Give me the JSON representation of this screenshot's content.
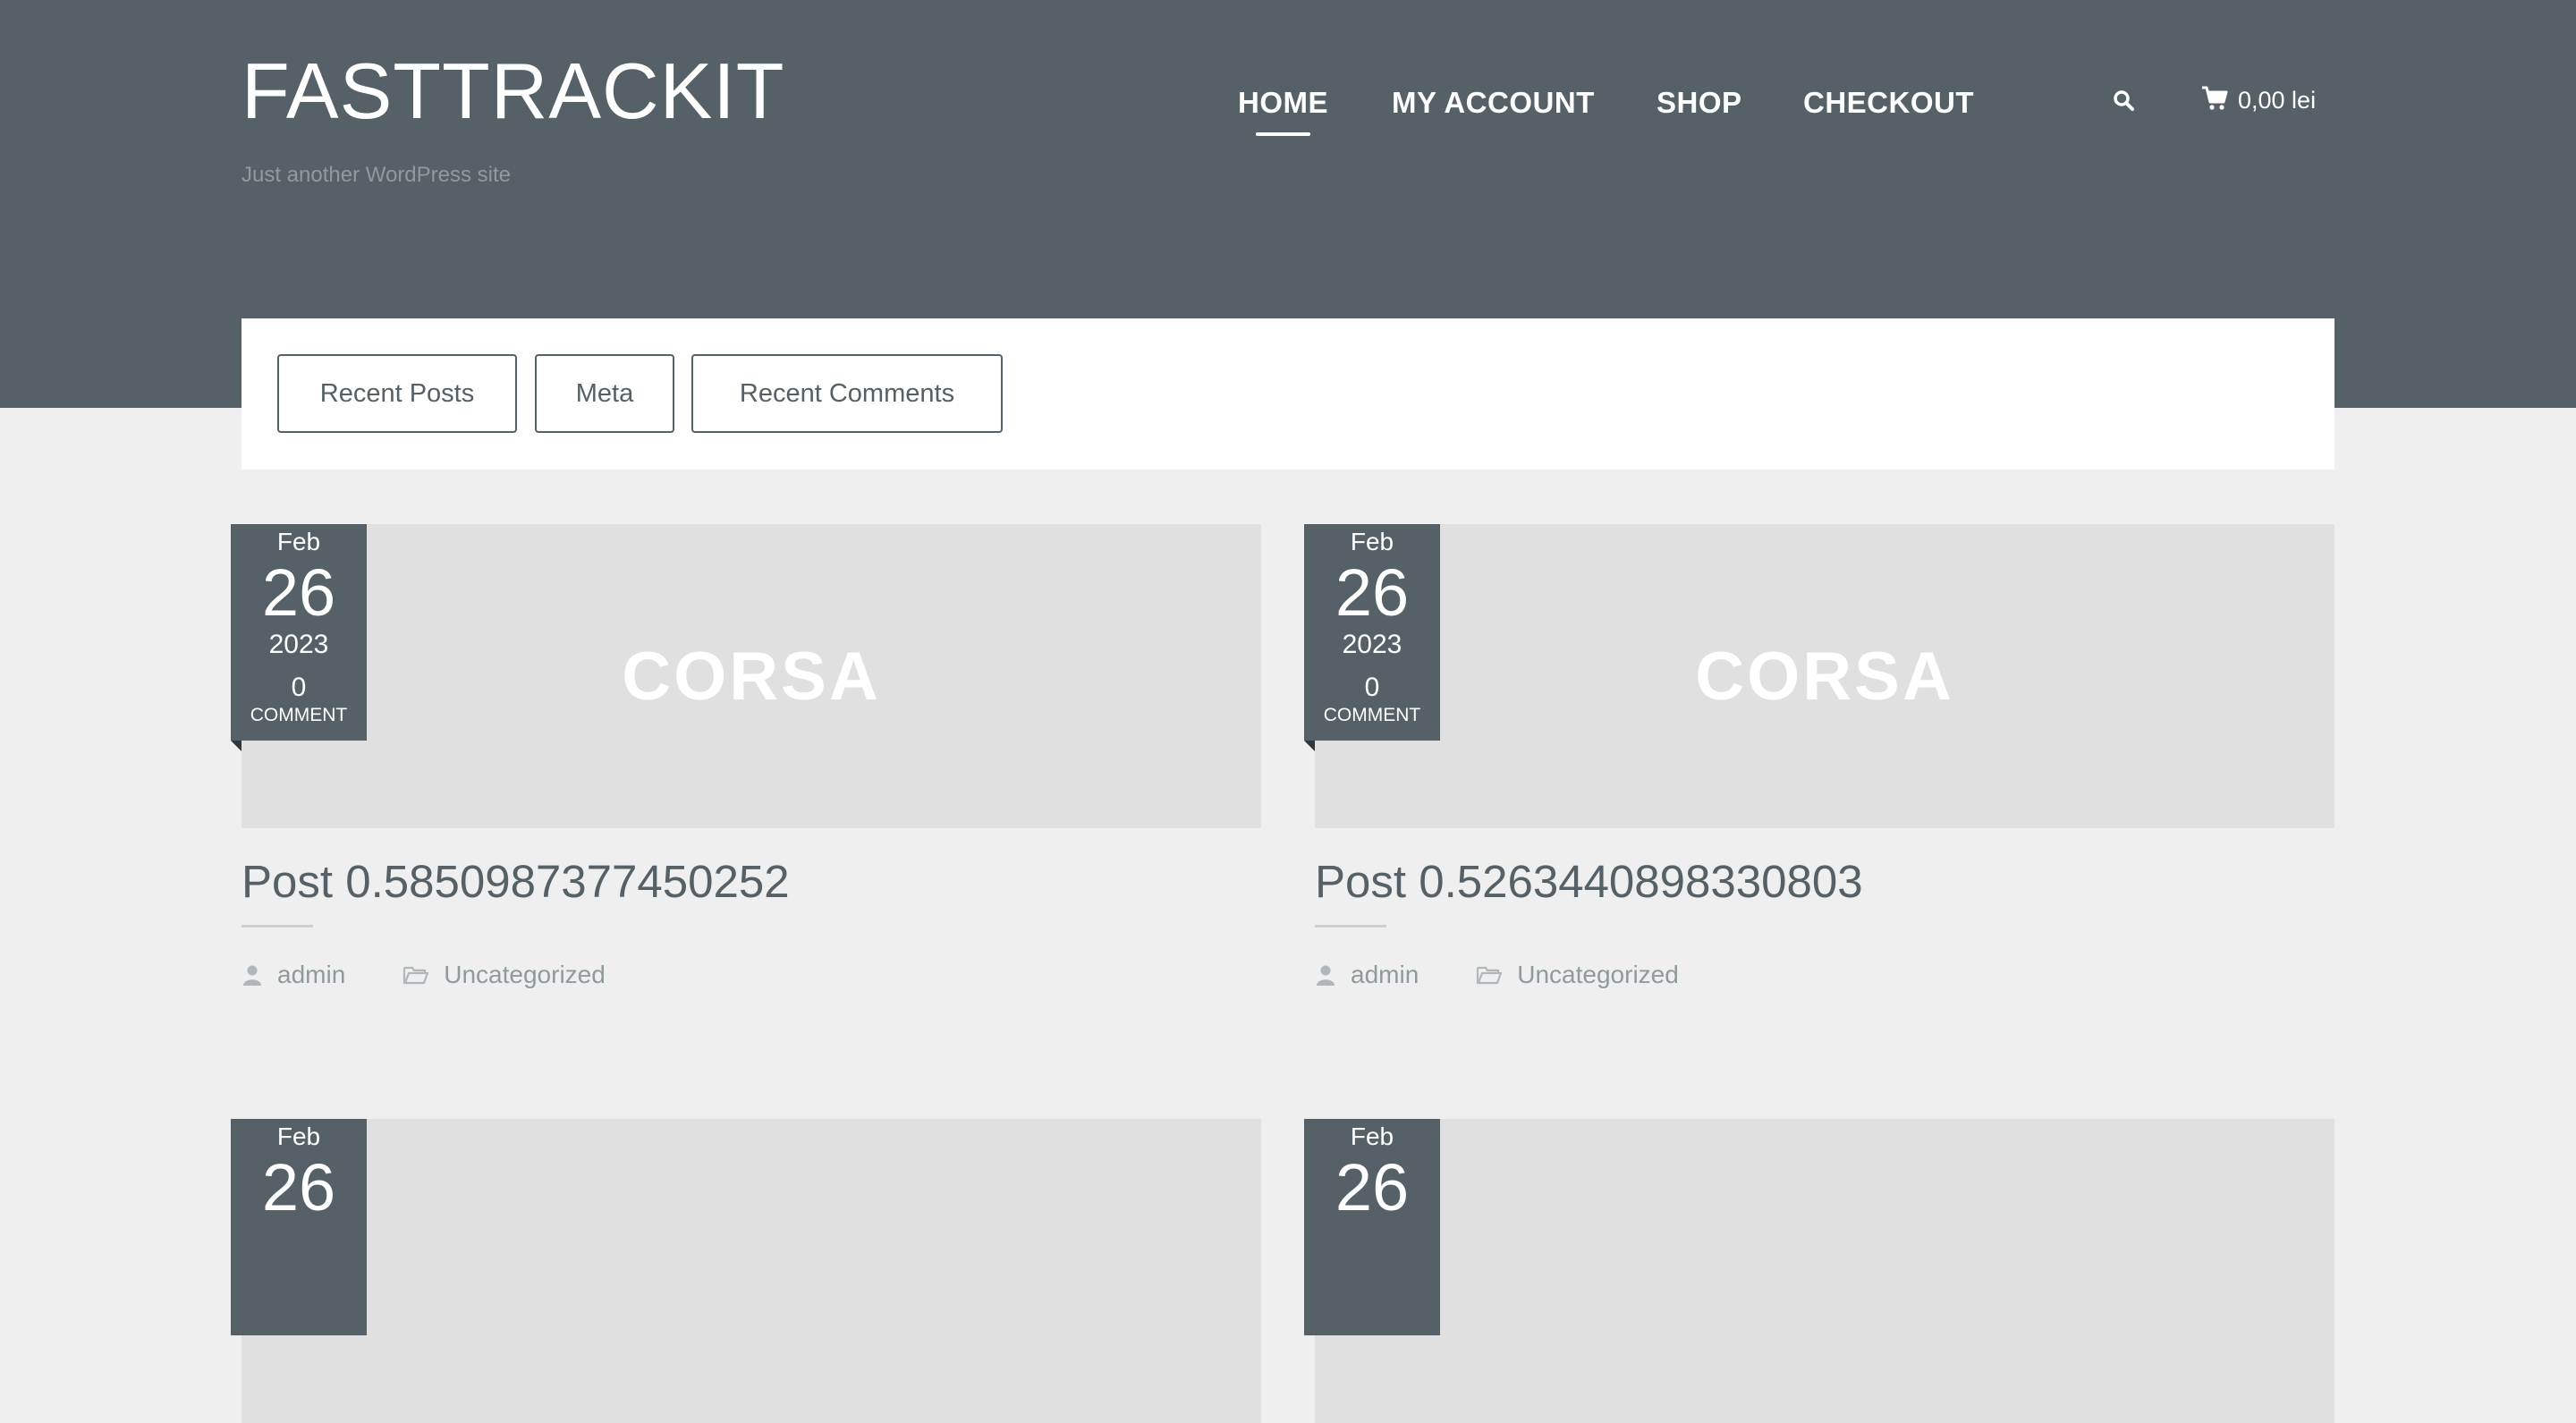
{
  "site": {
    "title": "FASTTRACKIT",
    "tagline": "Just another WordPress site"
  },
  "nav": {
    "items": [
      {
        "label": "HOME",
        "active": true
      },
      {
        "label": "MY ACCOUNT",
        "active": false
      },
      {
        "label": "SHOP",
        "active": false
      },
      {
        "label": "CHECKOUT",
        "active": false
      }
    ],
    "search_icon": "search-icon",
    "cart_icon": "cart-icon",
    "cart_total": "0,00 lei"
  },
  "widgets": {
    "buttons": [
      "Recent Posts",
      "Meta",
      "Recent Comments"
    ]
  },
  "posts": [
    {
      "month": "Feb",
      "day": "26",
      "year": "2023",
      "comment_count": "0",
      "comment_label": "COMMENT",
      "thumb_text": "CORSA",
      "title": "Post 0.5850987377450252",
      "author": "admin",
      "category": "Uncategorized"
    },
    {
      "month": "Feb",
      "day": "26",
      "year": "2023",
      "comment_count": "0",
      "comment_label": "COMMENT",
      "thumb_text": "CORSA",
      "title": "Post 0.5263440898330803",
      "author": "admin",
      "category": "Uncategorized"
    },
    {
      "month": "Feb",
      "day": "26"
    },
    {
      "month": "Feb",
      "day": "26"
    }
  ],
  "colors": {
    "header_bg": "#556166",
    "page_bg": "#efefef",
    "thumb_bg": "#e0e0e0",
    "muted_text": "#8f9a9e"
  }
}
